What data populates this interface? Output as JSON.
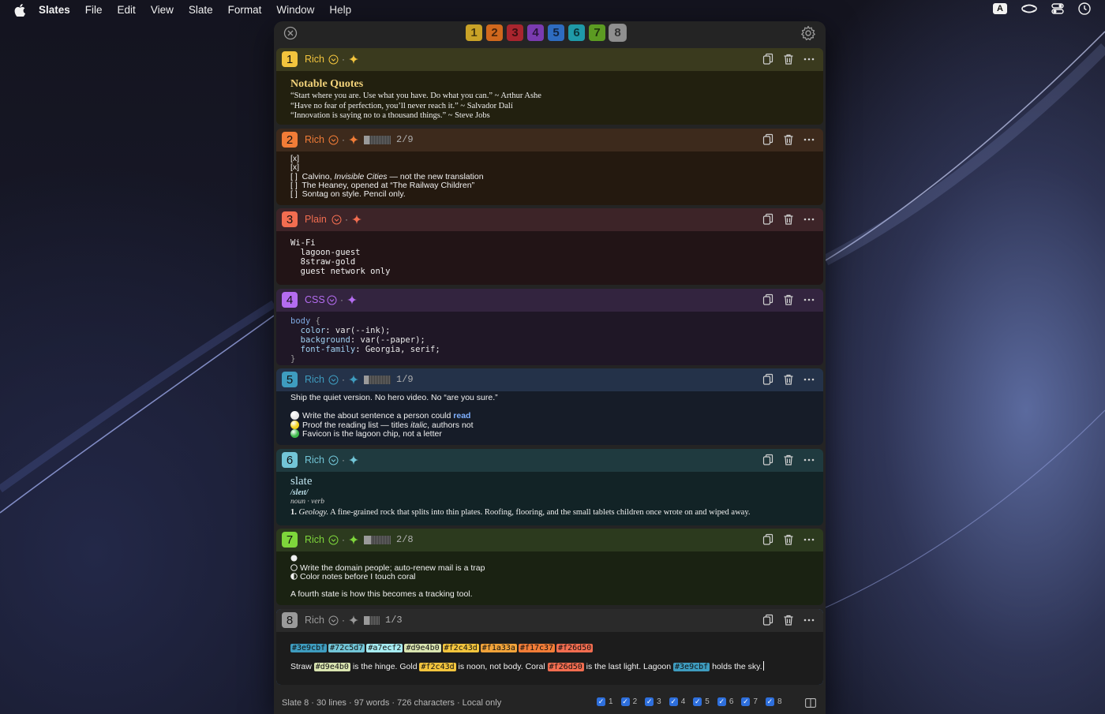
{
  "menubar": {
    "app_name": "Slates",
    "items": [
      "File",
      "Edit",
      "View",
      "Slate",
      "Format",
      "Window",
      "Help"
    ],
    "input_indicator": "A"
  },
  "tabs": [
    {
      "label": "1",
      "color": "#c9a227"
    },
    {
      "label": "2",
      "color": "#d0681d"
    },
    {
      "label": "3",
      "color": "#a8252e"
    },
    {
      "label": "4",
      "color": "#7a3bb0"
    },
    {
      "label": "5",
      "color": "#2e6cc0"
    },
    {
      "label": "6",
      "color": "#1f9aa8"
    },
    {
      "label": "7",
      "color": "#5c9b22"
    },
    {
      "label": "8",
      "color": "#8f8f8f"
    }
  ],
  "slates": [
    {
      "num": "1",
      "mode": "Rich",
      "accent": "#f2c43d",
      "head_bg": "#3a3a1e",
      "body_bg": "#22200f",
      "title": "Notable Quotes",
      "lines": [
        "“Start where you are. Use what you have. Do what you can.” ~ Arthur Ashe",
        "“Have no fear of perfection, you’ll never reach it.” ~ Salvador Dalí",
        "“Innovation is saying no to a thousand things.” ~ Steve Jobs"
      ]
    },
    {
      "num": "2",
      "mode": "Rich",
      "accent": "#f17c37",
      "head_bg": "#3d2a1c",
      "body_bg": "#24190f",
      "progress": "2/9",
      "progress_value": 0.22,
      "lines": [
        "[x]",
        "[x]",
        "[ ]  Calvino, ",
        "[ ]  The Heaney, opened at “The Railway Children”",
        "[ ]  Sontag on style. Pencil only."
      ],
      "italic": "Invisible Cities",
      "after_italic": " — not the new translation"
    },
    {
      "num": "3",
      "mode": "Plain",
      "accent": "#f26d50",
      "head_bg": "#3d2428",
      "body_bg": "#221416",
      "lines": [
        "Wi-Fi",
        "  lagoon-guest",
        "  8straw-gold",
        "  guest network only"
      ]
    },
    {
      "num": "4",
      "mode": "CSS",
      "accent": "#b46cf0",
      "head_bg": "#33243f",
      "body_bg": "#1f1726",
      "css": {
        "selector": "body",
        "brace_open": " {",
        "props": [
          {
            "p": "color",
            "v": "var(--ink);"
          },
          {
            "p": "background",
            "v": "var(--paper);"
          },
          {
            "p": "font-family",
            "v": "Georgia, serif;"
          }
        ],
        "brace_close": "}"
      }
    },
    {
      "num": "5",
      "mode": "Rich",
      "accent": "#3e9cbf",
      "head_bg": "#243249",
      "body_bg": "#161c28",
      "progress": "1/9",
      "progress_value": 0.11,
      "intro": "Ship the quiet version. No hero video. No “are you sure.”",
      "items": [
        {
          "text": "Write the about sentence a person could ",
          "link": "read",
          "color": "#e8e8e8"
        },
        {
          "text": "Proof the reading list — titles ",
          "italic": "italic",
          "rest": ", authors not",
          "color": "#f2d21b"
        },
        {
          "text": "Favicon is the lagoon chip, not a letter",
          "color": "#3cb84a"
        }
      ]
    },
    {
      "num": "6",
      "mode": "Rich",
      "accent": "#72c5d7",
      "head_bg": "#1f3a3f",
      "body_bg": "#122326",
      "word": "slate",
      "pron": "/sleɪt/",
      "pos": "noun · verb",
      "def_num": "1.",
      "def_field": "Geology.",
      "def": " A fine-grained rock that splits into thin plates. Roofing, flooring, and the small tablets children once wrote on and wiped away."
    },
    {
      "num": "7",
      "mode": "Rich",
      "accent": "#7ed63b",
      "head_bg": "#2c3a1e",
      "body_bg": "#1a2212",
      "progress": "2/8",
      "progress_value": 0.25,
      "lines": [
        "",
        "Write the domain people; auto-renew mail is a trap",
        "Color notes before I touch coral"
      ],
      "footer": "A fourth state is how this becomes a tracking tool."
    },
    {
      "num": "8",
      "mode": "Rich",
      "accent": "#9a9a9a",
      "head_bg": "#2a2a2a",
      "body_bg": "#1c1c1c",
      "progress": "1/3",
      "progress_value": 0.33,
      "swatches": [
        {
          "hex": "#3e9cbf"
        },
        {
          "hex": "#72c5d7"
        },
        {
          "hex": "#a7ecf2"
        },
        {
          "hex": "#d9e4b0"
        },
        {
          "hex": "#f2c43d"
        },
        {
          "hex": "#f1a33a"
        },
        {
          "hex": "#f17c37"
        },
        {
          "hex": "#f26d50"
        }
      ],
      "sentence": [
        {
          "t": "Straw "
        },
        {
          "c": "#d9e4b0"
        },
        {
          "t": " is the hinge. Gold "
        },
        {
          "c": "#f2c43d"
        },
        {
          "t": " is noon, not body. Coral "
        },
        {
          "c": "#f26d50"
        },
        {
          "t": " is the last light. Lagoon "
        },
        {
          "c": "#3e9cbf"
        },
        {
          "t": " holds the sky."
        }
      ]
    }
  ],
  "status": {
    "info": "Slate 8 · 30 lines · 97 words · 726 characters · Local only",
    "checks": [
      "1",
      "2",
      "3",
      "4",
      "5",
      "6",
      "7",
      "8"
    ]
  },
  "icons": {
    "close": "close-circle-icon",
    "gear": "gear-icon",
    "copy": "copy-icon",
    "trash": "trash-icon",
    "more": "ellipsis-icon",
    "chevron": "chevron-down-circle-icon",
    "sparkle": "sparkle-icon",
    "panel": "sidebar-panel-icon"
  }
}
